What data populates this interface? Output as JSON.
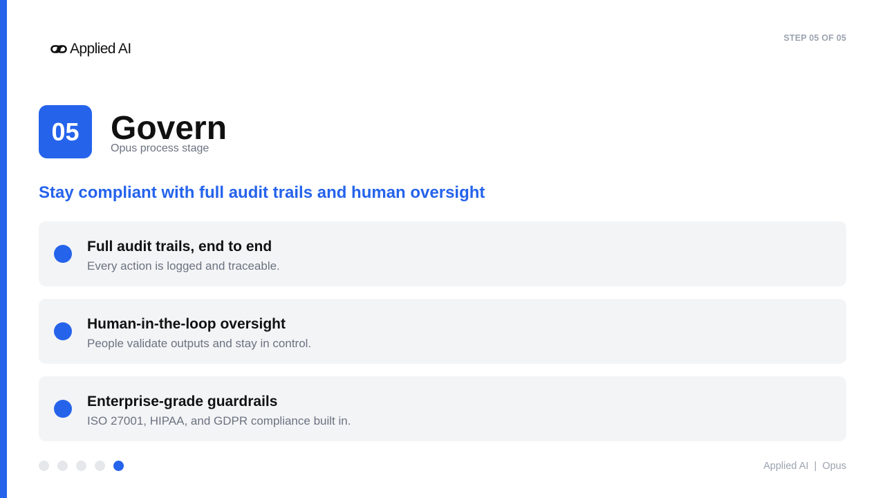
{
  "brand": {
    "logo_text": "Applied AI",
    "accent_color": "#2563eb"
  },
  "header": {
    "step_label": "STEP 05 OF 05"
  },
  "stage": {
    "number": "05",
    "title": "Govern",
    "subtitle": "Opus process stage"
  },
  "headline": "Stay compliant with full audit trails and human oversight",
  "cards": [
    {
      "title": "Full audit trails, end to end",
      "description": "Every action is logged and traceable."
    },
    {
      "title": "Human-in-the-loop oversight",
      "description": "People validate outputs and stay in control."
    },
    {
      "title": "Enterprise-grade guardrails",
      "description": "ISO 27001, HIPAA, and GDPR compliance built in."
    }
  ],
  "progress": {
    "total_steps": 5,
    "current_step": 5
  },
  "footer": {
    "brand": "Applied AI",
    "separator": "|",
    "product": "Opus"
  }
}
